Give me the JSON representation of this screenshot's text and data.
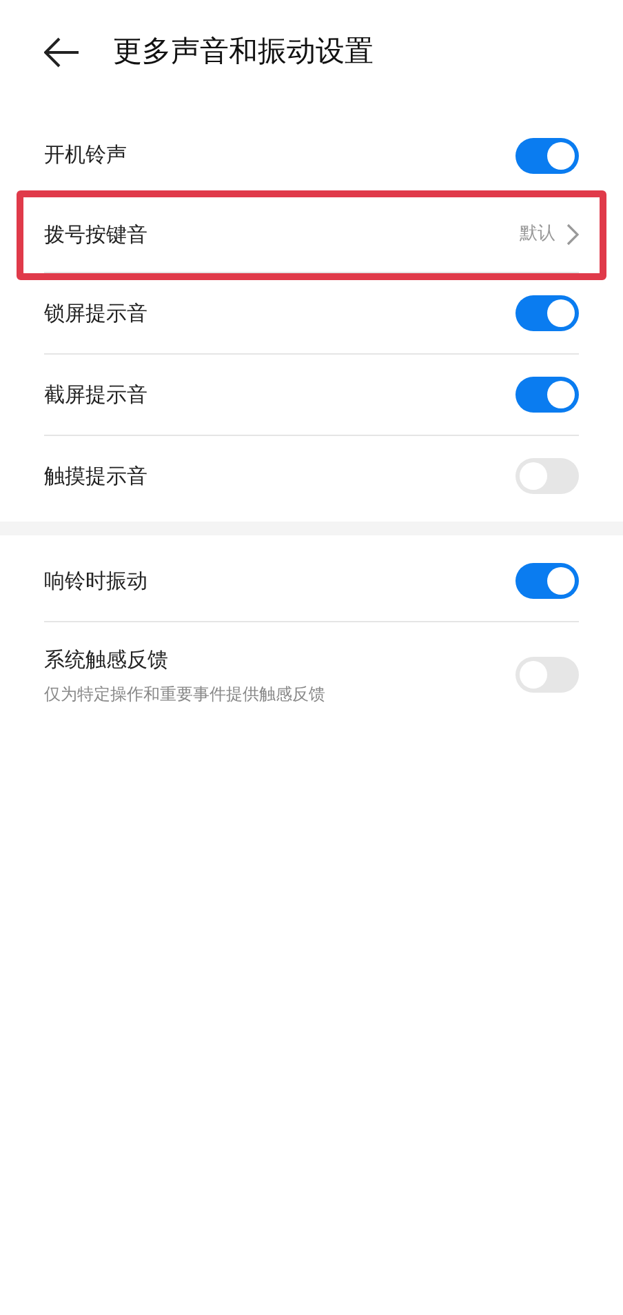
{
  "header": {
    "title": "更多声音和振动设置"
  },
  "sections": [
    {
      "items": [
        {
          "kind": "toggle",
          "label": "开机铃声",
          "on": true,
          "highlighted": false
        },
        {
          "kind": "link",
          "label": "拨号按键音",
          "value": "默认",
          "highlighted": true
        },
        {
          "kind": "toggle",
          "label": "锁屏提示音",
          "on": true,
          "highlighted": false
        },
        {
          "kind": "toggle",
          "label": "截屏提示音",
          "on": true,
          "highlighted": false
        },
        {
          "kind": "toggle",
          "label": "触摸提示音",
          "on": false,
          "highlighted": false
        }
      ]
    },
    {
      "items": [
        {
          "kind": "toggle",
          "label": "响铃时振动",
          "on": true,
          "highlighted": false
        },
        {
          "kind": "toggle",
          "label": "系统触感反馈",
          "description": "仅为特定操作和重要事件提供触感反馈",
          "on": false,
          "highlighted": false
        }
      ]
    }
  ]
}
